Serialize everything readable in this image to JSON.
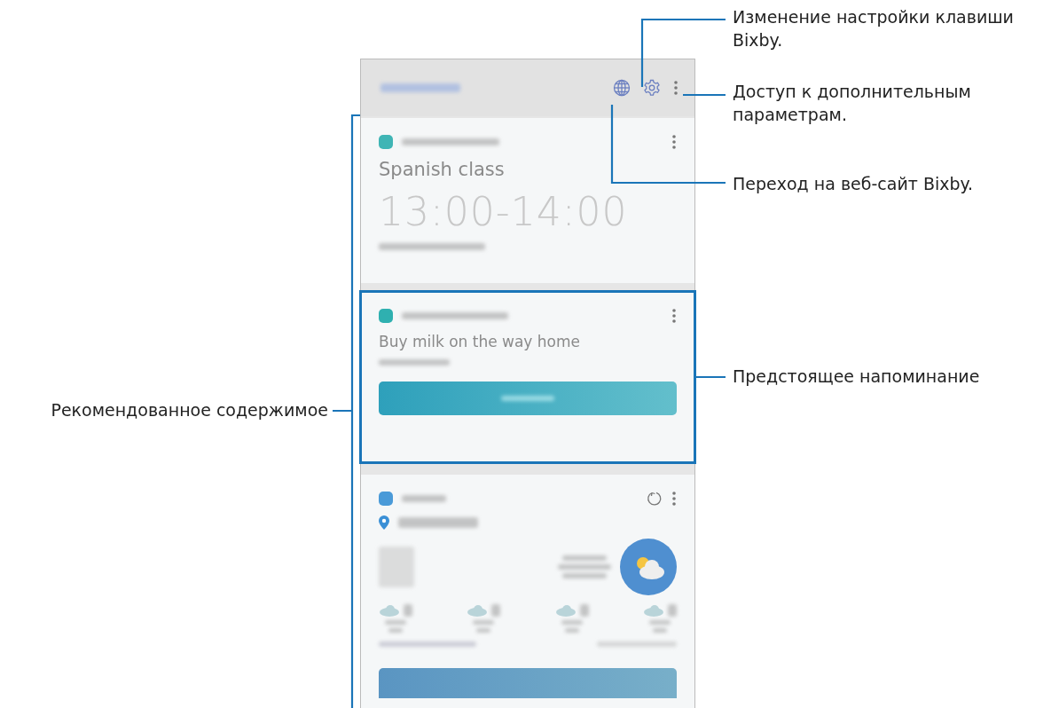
{
  "schedule_card": {
    "title": "Spanish class",
    "time": "13:00-14:00"
  },
  "reminder_card": {
    "title": "Buy milk on the way home",
    "highlighted": true
  },
  "callouts": [
    {
      "text": "Изменение настройки клавиши Bixby."
    },
    {
      "text": "Доступ к дополнительным параметрам."
    },
    {
      "text": "Переход на веб-сайт Bixby."
    },
    {
      "text": "Предстоящее напоминание"
    },
    {
      "text": "Рекомендованное содержимое"
    }
  ]
}
